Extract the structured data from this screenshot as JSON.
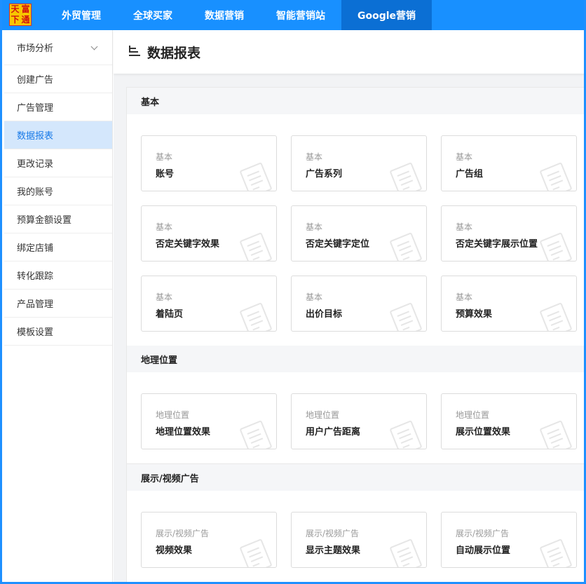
{
  "logo": {
    "chars": [
      "天",
      "富",
      "下",
      "通"
    ]
  },
  "topnav": {
    "items": [
      {
        "label": "外贸管理"
      },
      {
        "label": "全球买家"
      },
      {
        "label": "数据营销"
      },
      {
        "label": "智能营销站"
      },
      {
        "label": "Google营销",
        "active": true
      }
    ]
  },
  "sidebar": {
    "items": [
      {
        "label": "市场分析"
      },
      {
        "label": "创建广告"
      },
      {
        "label": "广告管理"
      },
      {
        "label": "数据报表",
        "active": true
      },
      {
        "label": "更改记录"
      },
      {
        "label": "我的账号"
      },
      {
        "label": "预算金额设置"
      },
      {
        "label": "绑定店铺"
      },
      {
        "label": "转化跟踪"
      },
      {
        "label": "产品管理"
      },
      {
        "label": "模板设置"
      }
    ]
  },
  "page": {
    "title": "数据报表"
  },
  "sections": [
    {
      "title": "基本",
      "cards": [
        {
          "category": "基本",
          "name": "账号"
        },
        {
          "category": "基本",
          "name": "广告系列"
        },
        {
          "category": "基本",
          "name": "广告组"
        },
        {
          "category": "基本",
          "name": "否定关键字效果"
        },
        {
          "category": "基本",
          "name": "否定关键字定位"
        },
        {
          "category": "基本",
          "name": "否定关键字展示位置"
        },
        {
          "category": "基本",
          "name": "着陆页"
        },
        {
          "category": "基本",
          "name": "出价目标"
        },
        {
          "category": "基本",
          "name": "预算效果"
        }
      ]
    },
    {
      "title": "地理位置",
      "cards": [
        {
          "category": "地理位置",
          "name": "地理位置效果"
        },
        {
          "category": "地理位置",
          "name": "用户广告距离"
        },
        {
          "category": "地理位置",
          "name": "展示位置效果"
        }
      ]
    },
    {
      "title": "展示/视频广告",
      "cards": [
        {
          "category": "展示/视频广告",
          "name": "视频效果"
        },
        {
          "category": "展示/视频广告",
          "name": "显示主题效果"
        },
        {
          "category": "展示/视频广告",
          "name": "自动展示位置"
        }
      ]
    }
  ]
}
